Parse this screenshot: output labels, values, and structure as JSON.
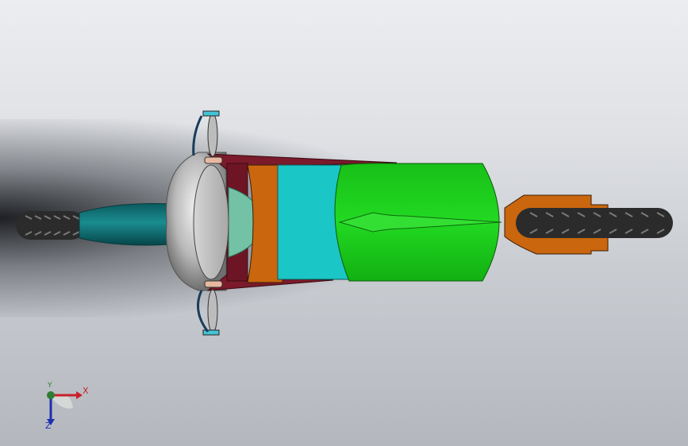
{
  "triad": {
    "x_label": "X",
    "y_label": "Y",
    "z_label": "Z"
  },
  "colors": {
    "background_top": "#ecedf0",
    "background_bottom": "#b4b8be",
    "seat_green": "#1fcf1f",
    "tank_cyan": "#1bc6c6",
    "body_orange": "#c9660e",
    "frame_maroon": "#7a1a2a",
    "rear_teal": "#0e6e72",
    "tire_black": "#2a2a2a",
    "headlight_grey": "#c2c2c2",
    "axis_x": "#c8202a",
    "axis_y": "#2e7d32",
    "axis_z": "#1f2fb0"
  },
  "icons": [
    "coordinate-triad-icon"
  ]
}
